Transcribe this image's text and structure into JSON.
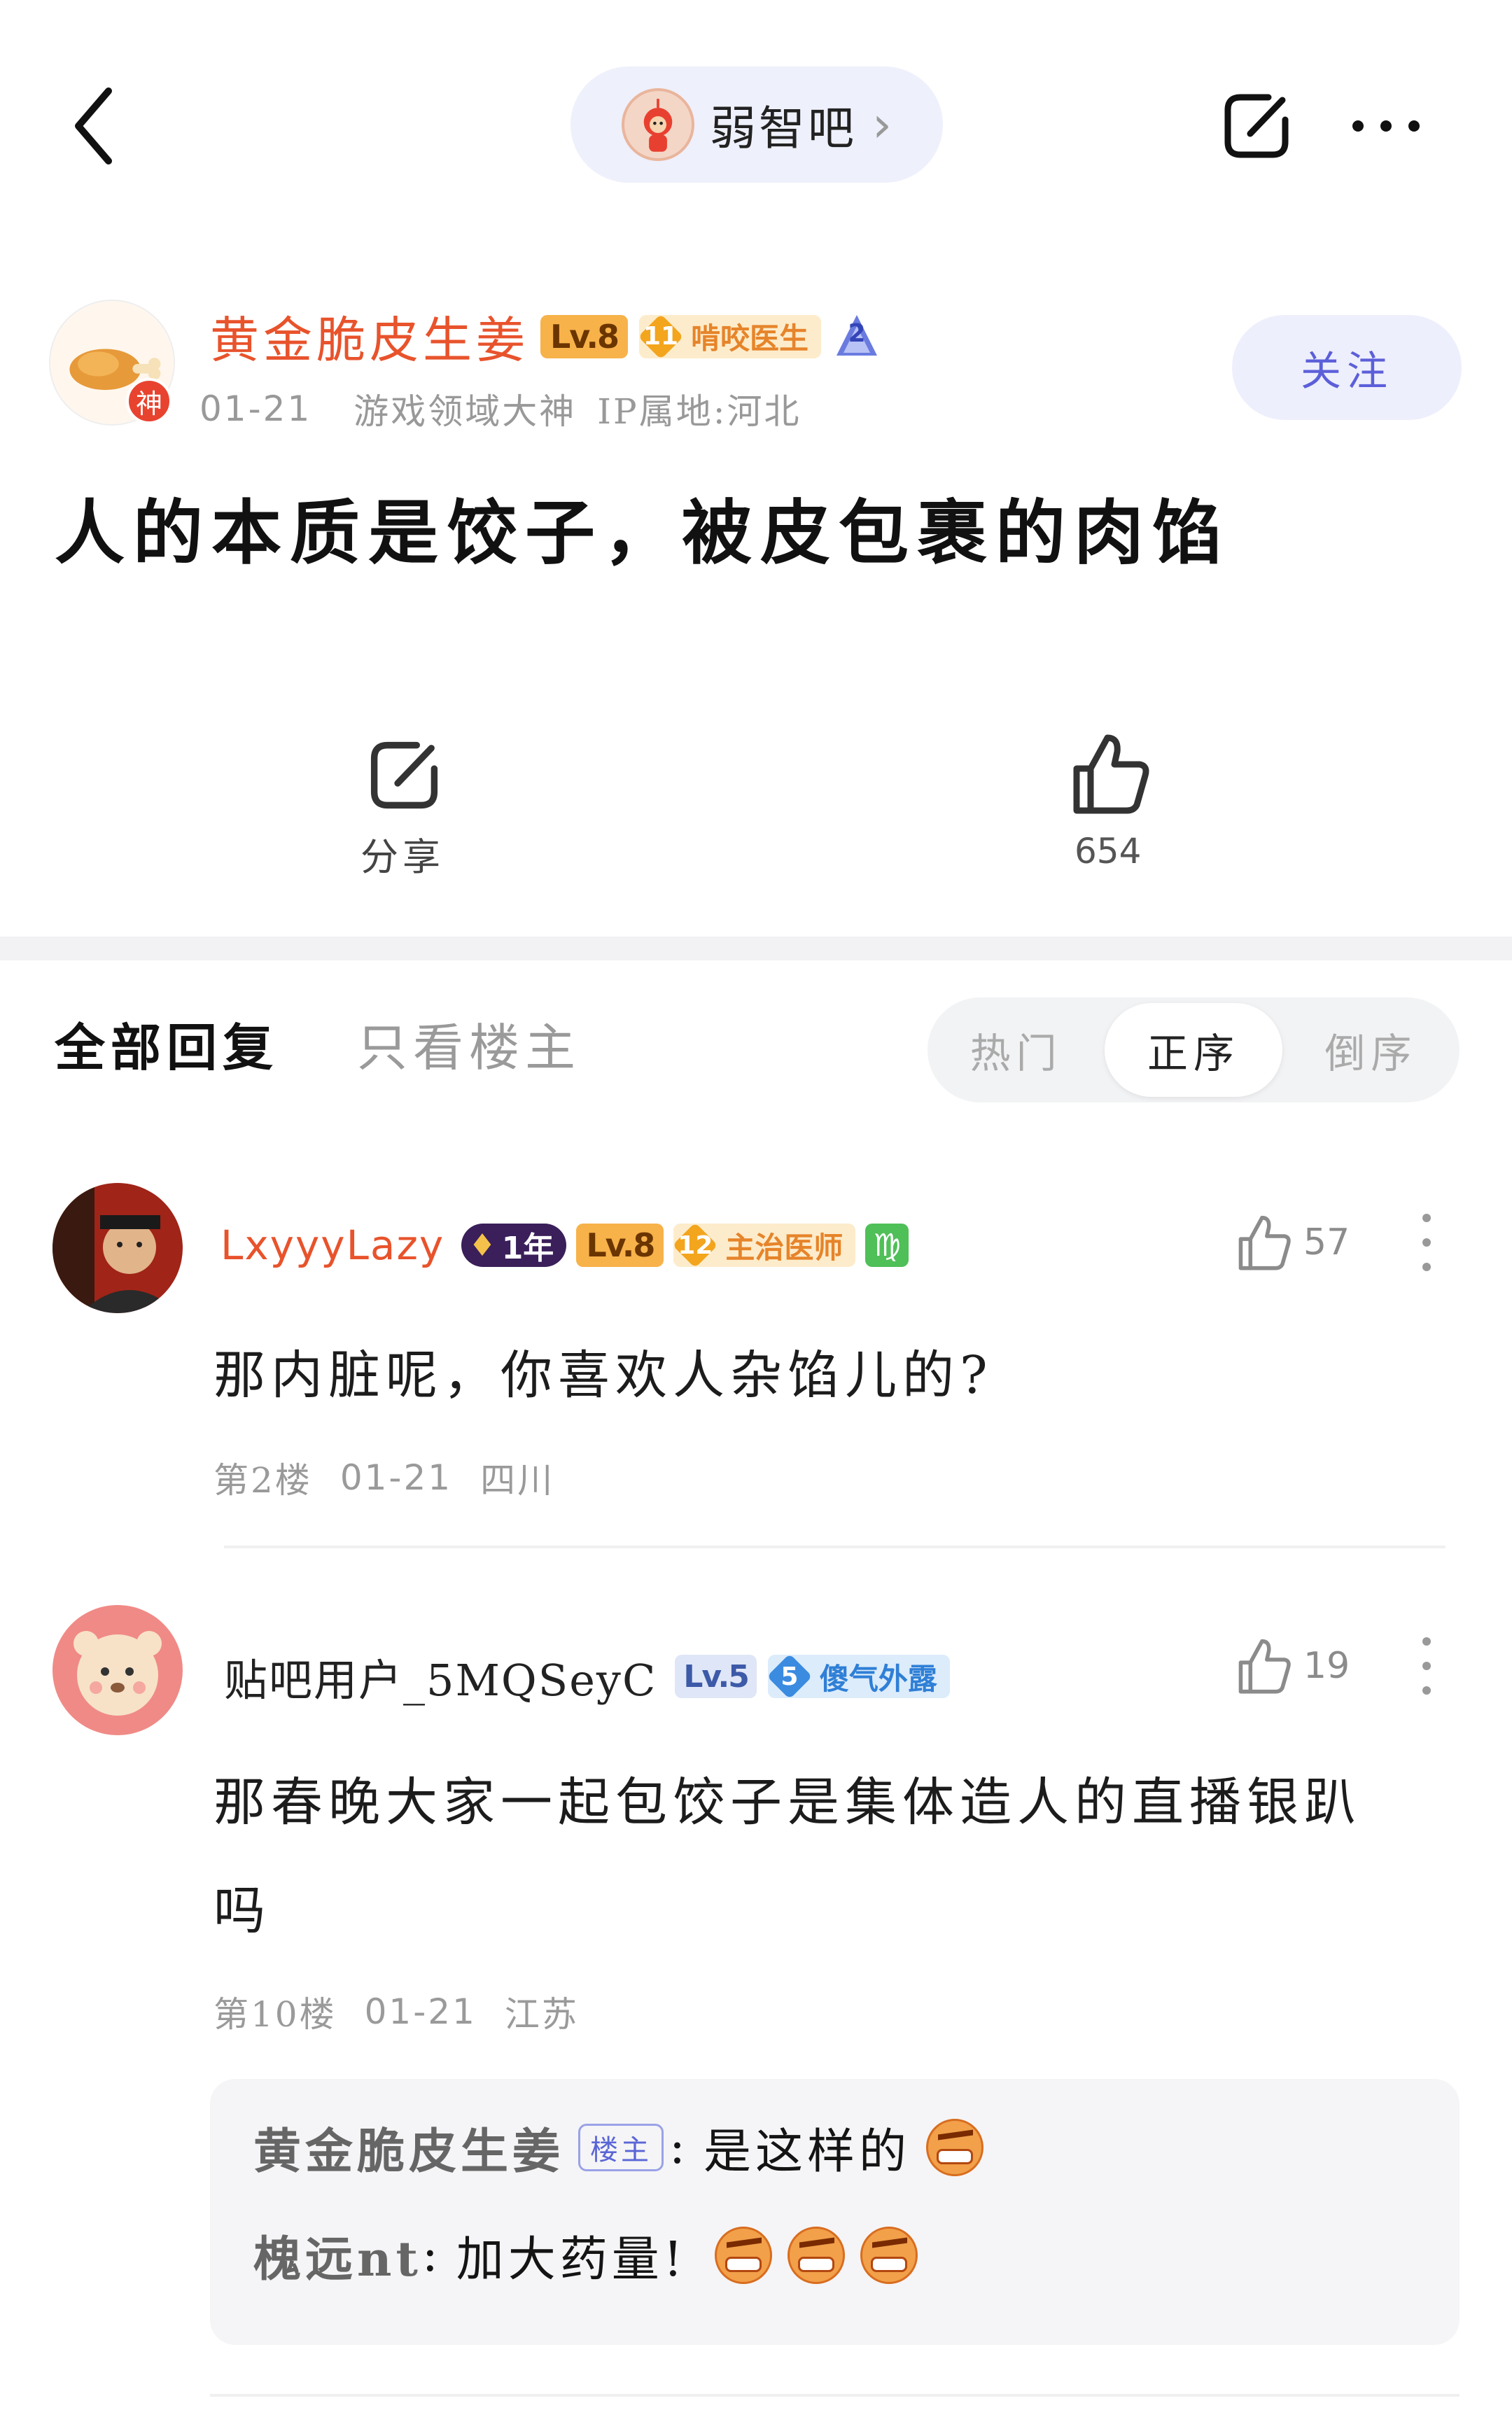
{
  "topbar": {
    "forum_name": "弱智吧",
    "forum_chevron": "›"
  },
  "post": {
    "author": {
      "name": "黄金脆皮生姜",
      "level": "Lv.8",
      "badge_num": "11",
      "badge_title": "啃咬医生",
      "rank_num": "2",
      "god_badge": "神",
      "date": "01-21",
      "honor": "游戏领域大神",
      "ip": "IP属地:河北"
    },
    "follow_label": "关注",
    "title": "人的本质是饺子，被皮包裹的肉馅",
    "share_label": "分享",
    "like_count": "654"
  },
  "tabs": {
    "all": "全部回复",
    "owner_only": "只看楼主",
    "sort": [
      "热门",
      "正序",
      "倒序"
    ],
    "sort_active": "正序"
  },
  "comments": [
    {
      "user": "LxyyyLazy",
      "year_badge": "1年",
      "level": "Lv.8",
      "badge_num": "12",
      "badge_title": "主治医师",
      "zodiac": "♍",
      "likes": "57",
      "text": "那内脏呢，你喜欢人杂馅儿的?",
      "floor": "第2楼",
      "date": "01-21",
      "location": "四川"
    },
    {
      "user": "贴吧用户_5MQSeyC",
      "level": "Lv.5",
      "badge_num": "5",
      "badge_title": "傻气外露",
      "likes": "19",
      "text_line1": "那春晚大家一起包饺子是集体造人的直播银趴",
      "text_line2": "吗",
      "floor": "第10楼",
      "date": "01-21",
      "location": "江苏",
      "replies": [
        {
          "user": "黄金脆皮生姜",
          "tag": "楼主",
          "text": "是这样的"
        },
        {
          "user": "槐远nt",
          "text": "加大药量!"
        }
      ]
    }
  ],
  "colors": {
    "accent": "#5c5fd9",
    "author_name": "#e8532c",
    "level_badge": "#f7b24a",
    "pill_bg": "#eef0fb"
  }
}
